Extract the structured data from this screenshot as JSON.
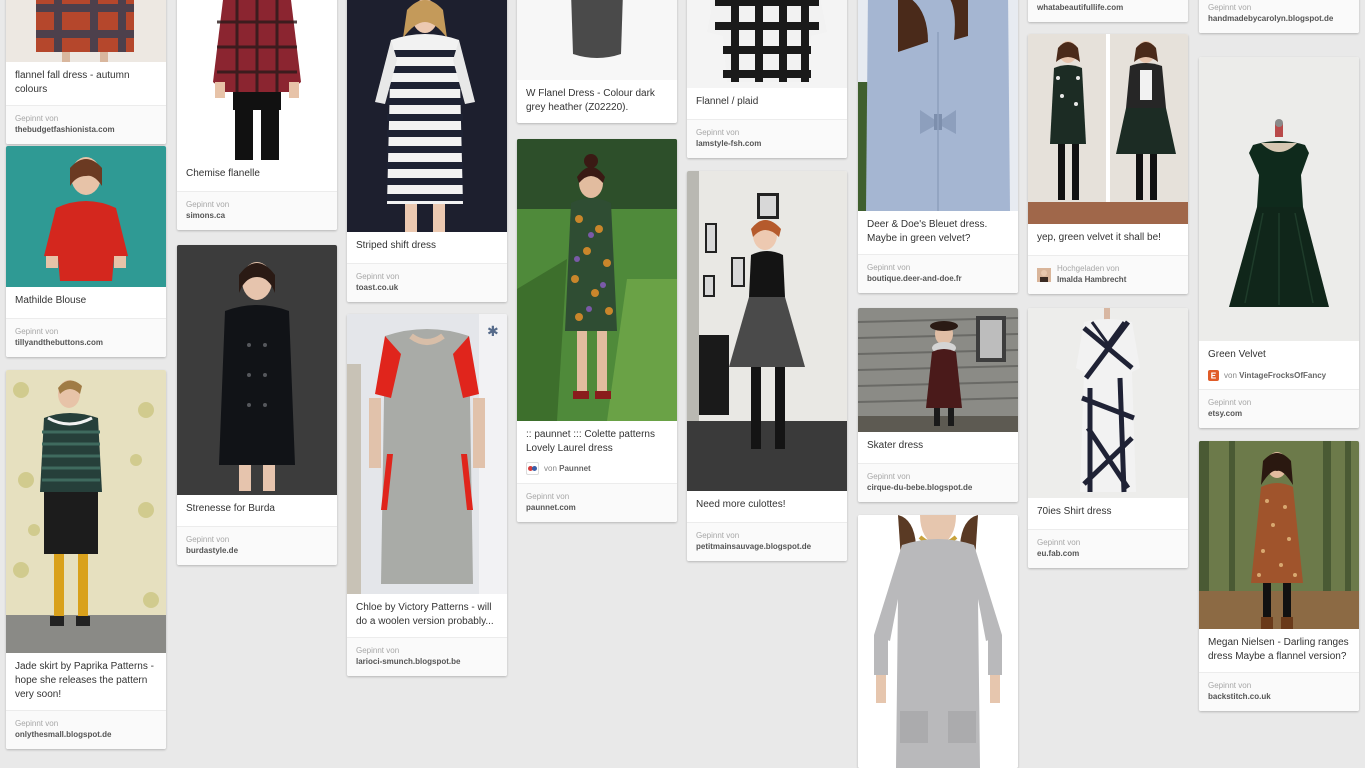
{
  "columns": [
    {
      "pins": [
        {
          "description": "flannel fall dress - autumn colours",
          "meta_label": "Gepinnt von",
          "source": "thebudgetfashionista.com",
          "image": "plaid-orange-dress"
        },
        {
          "description": "Mathilde Blouse",
          "meta_label": "Gepinnt von",
          "source": "tillyandthebuttons.com",
          "image": "red-blouse"
        },
        {
          "description": "Jade skirt by Paprika Patterns - hope she releases the pattern very soon!",
          "meta_label": "Gepinnt von",
          "source": "onlythesmall.blogspot.de",
          "image": "striped-top-skirt"
        }
      ]
    },
    {
      "pins": [
        {
          "description": "Chemise flanelle",
          "meta_label": "Gepinnt von",
          "source": "simons.ca",
          "image": "plaid-shirt"
        },
        {
          "description": "Strenesse for Burda",
          "meta_label": "Gepinnt von",
          "source": "burdastyle.de",
          "image": "black-coat"
        }
      ]
    },
    {
      "pins": [
        {
          "description": "Striped shift dress",
          "meta_label": "Gepinnt von",
          "source": "toast.co.uk",
          "image": "striped-dress"
        },
        {
          "description": "Chloe by Victory Patterns - will do a woolen version probably...",
          "meta_label": "Gepinnt von",
          "source": "larioci-smunch.blogspot.be",
          "image": "grey-red-dress"
        }
      ]
    },
    {
      "pins": [
        {
          "description": "W Flanel Dress - Colour dark grey heather (Z02220).",
          "image": "grey-dress-top"
        },
        {
          "description": ":: paunnet ::: Colette patterns Lovely Laurel dress",
          "attribution_prefix": "von",
          "attribution_name": "Paunnet",
          "meta_label": "Gepinnt von",
          "source": "paunnet.com",
          "image": "floral-dress-outdoor"
        }
      ]
    },
    {
      "pins": [
        {
          "description": "Flannel / plaid",
          "meta_label": "Gepinnt von",
          "source": "lamstyle-fsh.com",
          "image": "bw-plaid-shirt"
        },
        {
          "description": "Need more culottes!",
          "meta_label": "Gepinnt von",
          "source": "petitmainsauvage.blogspot.de",
          "image": "black-skirt-room"
        }
      ]
    },
    {
      "pins": [
        {
          "description": "Deer & Doe's Bleuet dress. Maybe in green velvet?",
          "meta_label": "Gepinnt von",
          "source": "boutique.deer-and-doe.fr",
          "image": "blue-bow-dress"
        },
        {
          "description": "Skater dress",
          "meta_label": "Gepinnt von",
          "source": "cirque-du-bebe.blogspot.de",
          "image": "skater-dress-barn"
        },
        {
          "description": "",
          "image": "grey-sweater-dress"
        }
      ]
    },
    {
      "pins": [
        {
          "description": "",
          "source": "whatabeautifullife.com",
          "image": "none"
        },
        {
          "description": "yep, green velvet it shall be!",
          "attribution_prefix": "Hochgeladen von",
          "attribution_name": "Imalda Hambrecht",
          "image": "green-velvet-pair"
        },
        {
          "description": "70ies Shirt dress",
          "meta_label": "Gepinnt von",
          "source": "eu.fab.com",
          "image": "geometric-shirt-dress"
        }
      ]
    },
    {
      "pins": [
        {
          "description": "",
          "meta_label": "Gepinnt von",
          "source": "handmadebycarolyn.blogspot.de",
          "image": "none"
        },
        {
          "description": "Green Velvet",
          "attribution_prefix": "von",
          "attribution_name": "VintageFrocksOfFancy",
          "meta_label": "Gepinnt von",
          "source": "etsy.com",
          "image": "green-velvet-mannequin"
        },
        {
          "description": "Megan Nielsen - Darling ranges dress Maybe a flannel version?",
          "meta_label": "Gepinnt von",
          "source": "backstitch.co.uk",
          "image": "brown-print-dress"
        }
      ]
    }
  ],
  "colors": {
    "background": "#e9e9e9",
    "card": "#ffffff",
    "meta_label": "#a7a7a7",
    "attribution_icon_paunnet": "#3a5fa8",
    "attribution_icon_etsy": "#e05c28"
  }
}
